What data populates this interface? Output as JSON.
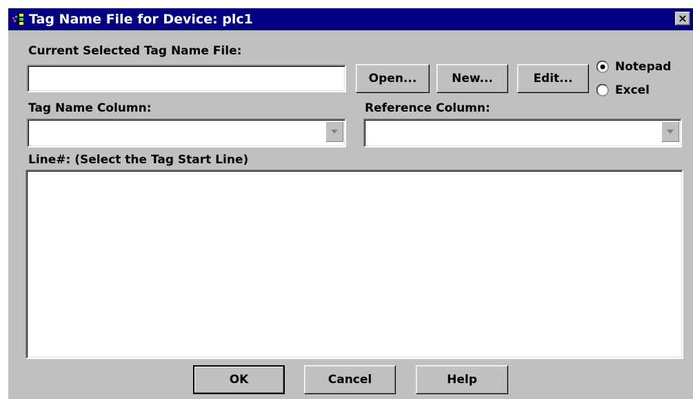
{
  "window": {
    "title": "Tag Name File for Device: plc1",
    "close_label": "×"
  },
  "file_section": {
    "label": "Current Selected Tag Name File:",
    "value": "",
    "open_button": "Open...",
    "new_button": "New...",
    "edit_button": "Edit..."
  },
  "editor": {
    "options": [
      {
        "label": "Notepad",
        "selected": true
      },
      {
        "label": "Excel",
        "selected": false
      }
    ]
  },
  "tag_name_column": {
    "label": "Tag Name Column:",
    "value": ""
  },
  "reference_column": {
    "label": "Reference Column:",
    "value": ""
  },
  "line_list": {
    "label": "Line#: (Select the Tag Start Line)",
    "items": []
  },
  "footer": {
    "ok_button": "OK",
    "cancel_button": "Cancel",
    "help_button": "Help"
  },
  "colors": {
    "titlebar": "#000080",
    "dialog_face": "#c0c0c0",
    "field_background": "#ffffff"
  },
  "icons": {
    "app_icon": "application-icon",
    "close_icon": "close-icon",
    "dropdown_arrow": "chevron-down-icon"
  }
}
